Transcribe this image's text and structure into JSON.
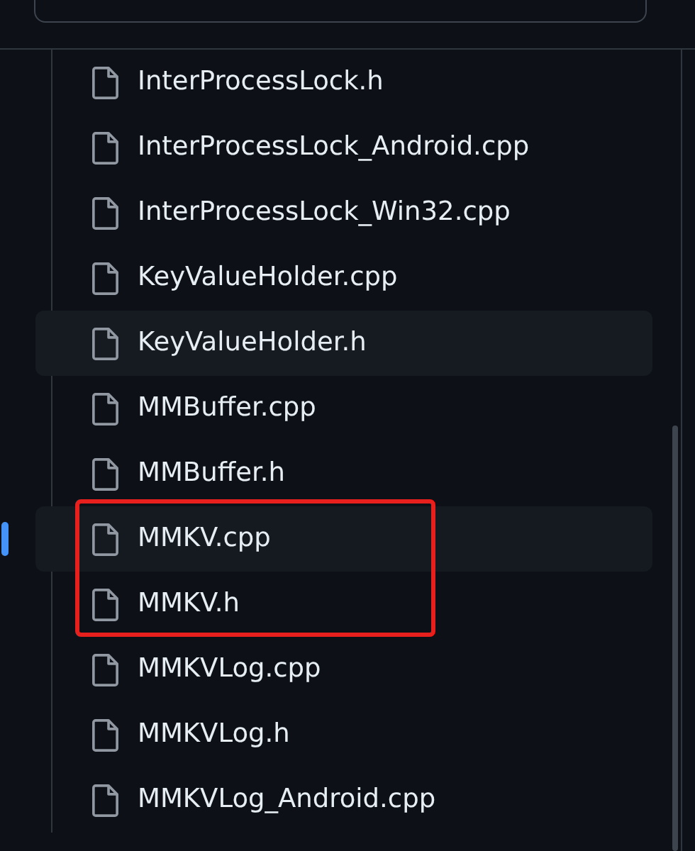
{
  "search": {
    "kind": "field"
  },
  "files": [
    {
      "name": "InterProcessLock.h",
      "selected": false,
      "hovered": false,
      "boxed": false
    },
    {
      "name": "InterProcessLock_Android.cpp",
      "selected": false,
      "hovered": false,
      "boxed": false
    },
    {
      "name": "InterProcessLock_Win32.cpp",
      "selected": false,
      "hovered": false,
      "boxed": false
    },
    {
      "name": "KeyValueHolder.cpp",
      "selected": false,
      "hovered": false,
      "boxed": false
    },
    {
      "name": "KeyValueHolder.h",
      "selected": false,
      "hovered": true,
      "boxed": false
    },
    {
      "name": "MMBuffer.cpp",
      "selected": false,
      "hovered": false,
      "boxed": false
    },
    {
      "name": "MMBuffer.h",
      "selected": false,
      "hovered": false,
      "boxed": false
    },
    {
      "name": "MMKV.cpp",
      "selected": true,
      "hovered": false,
      "boxed": true
    },
    {
      "name": "MMKV.h",
      "selected": false,
      "hovered": false,
      "boxed": true
    },
    {
      "name": "MMKVLog.cpp",
      "selected": false,
      "hovered": false,
      "boxed": false
    },
    {
      "name": "MMKVLog.h",
      "selected": false,
      "hovered": false,
      "boxed": false
    },
    {
      "name": "MMKVLog_Android.cpp",
      "selected": false,
      "hovered": false,
      "boxed": false
    }
  ]
}
